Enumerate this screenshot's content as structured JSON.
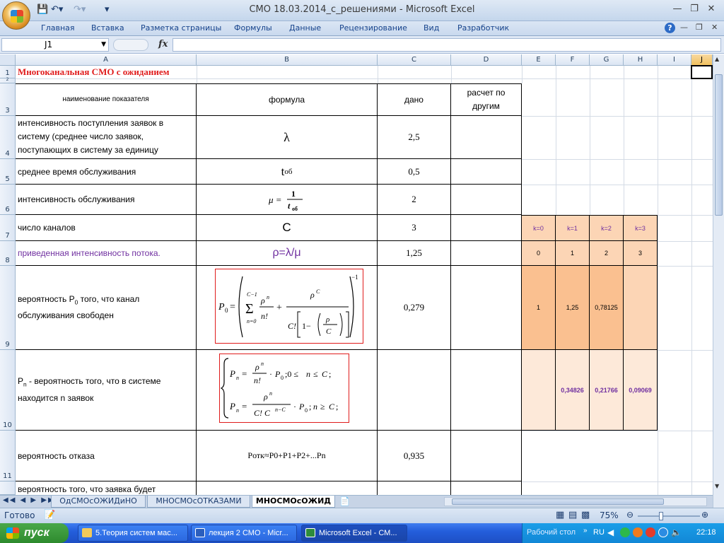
{
  "window": {
    "title": "СМО 18.03.2014_с_решениями - Microsoft Excel"
  },
  "ribbon": {
    "tabs": [
      "Главная",
      "Вставка",
      "Разметка страницы",
      "Формулы",
      "Данные",
      "Рецензирование",
      "Вид",
      "Разработчик"
    ]
  },
  "formula_bar": {
    "name_box": "J1",
    "fx": "fx",
    "value": ""
  },
  "columns": [
    "A",
    "B",
    "C",
    "D",
    "E",
    "F",
    "G",
    "H",
    "I",
    "J"
  ],
  "rows": [
    "1",
    "2",
    "3",
    "4",
    "5",
    "6",
    "7",
    "8",
    "9",
    "10",
    "11"
  ],
  "sheet": {
    "title": "Многоканальная СМО с ожиданием",
    "headers": {
      "name": "наименование показателя",
      "formula": "формула",
      "given": "дано",
      "calc": "расчет по другим"
    },
    "r4": {
      "name": "интенсивность поступления заявок в систему (среднее число заявок, поступающих в систему за единицу",
      "formula": "λ",
      "given": "2,5"
    },
    "r5": {
      "name": "среднее время обслуживания",
      "formula": "t",
      "formula_sub": "об",
      "given": "0,5"
    },
    "r6": {
      "name": "интенсивность обслуживания",
      "given": "2"
    },
    "r7": {
      "name": "число каналов",
      "formula": "C",
      "given": "3",
      "k": [
        "k=0",
        "k=1",
        "k=2",
        "k=3"
      ]
    },
    "r8": {
      "name": "приведенная интенсивность потока.",
      "formula": "ρ=λ/μ",
      "given": "1,25",
      "n": [
        "0",
        "1",
        "2",
        "3"
      ]
    },
    "r9": {
      "name_a": "вероятность P",
      "name_sub": "0",
      "name_b": " того, что канал обслуживания свободен",
      "given": "0,279",
      "vals": [
        "1",
        "1,25",
        "0,78125",
        ""
      ]
    },
    "r10": {
      "name_a": "P",
      "name_sub": "n",
      "name_b": "  - вероятность того, что в системе находится n заявок",
      "vals": [
        "",
        "0,34826",
        "0,21766",
        "0,09069"
      ]
    },
    "r11": {
      "name": "вероятность отказа",
      "formula": "Pотк≈P0+P1+P2+...Pn",
      "given": "0,935"
    },
    "r12": {
      "name": "вероятность того, что заявка будет"
    }
  },
  "sheet_tabs": [
    "ОдСМОсОЖИДиНО",
    "МНОСМОсОТКАЗАМИ",
    "МНОСМОсОЖИД"
  ],
  "status": {
    "ready": "Готово",
    "zoom": "75%"
  },
  "taskbar": {
    "start": "пуск",
    "tasks": [
      "5.Теория систем мас...",
      "лекция 2 СМО - Micr...",
      "Microsoft Excel - СМ..."
    ],
    "desktop": "Рабочий стол",
    "lang": "RU",
    "time": "22:18"
  },
  "colors": {
    "title_red": "#e01c1c",
    "peach": "#fcd5b5",
    "peach_dark": "#fac090",
    "purple": "#7030a0",
    "taskbar": "#245edc",
    "start_green": "#3a9a3a"
  }
}
